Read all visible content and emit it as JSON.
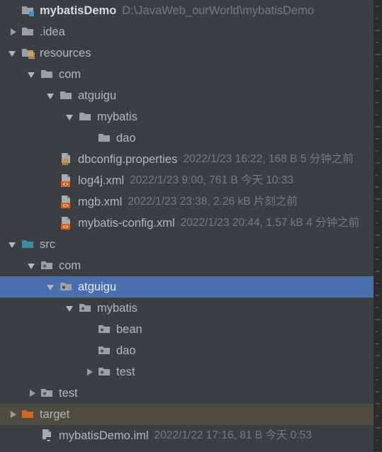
{
  "window": {
    "panel": "project-tree",
    "background_color": "#3c3f41",
    "selection_color": "#4b6eaf",
    "excluded_color": "#4e4b3f"
  },
  "tree": {
    "rows": [
      {
        "label": "mybatisDemo",
        "meta": "D:\\JavaWeb_ourWorld\\mybatisDemo",
        "meta_kind": "path",
        "icon": "project-folder-icon",
        "arrow": "none",
        "depth": 0,
        "bold": true,
        "state": "normal"
      },
      {
        "label": ".idea",
        "meta": "",
        "meta_kind": "none",
        "icon": "folder-icon",
        "arrow": "collapsed",
        "depth": 0,
        "bold": false,
        "state": "normal"
      },
      {
        "label": "resources",
        "meta": "",
        "meta_kind": "none",
        "icon": "resource-root-folder-icon",
        "arrow": "expanded",
        "depth": 0,
        "bold": false,
        "state": "normal"
      },
      {
        "label": "com",
        "meta": "",
        "meta_kind": "none",
        "icon": "folder-icon",
        "arrow": "expanded",
        "depth": 1,
        "bold": false,
        "state": "normal"
      },
      {
        "label": "atguigu",
        "meta": "",
        "meta_kind": "none",
        "icon": "folder-icon",
        "arrow": "expanded",
        "depth": 2,
        "bold": false,
        "state": "normal"
      },
      {
        "label": "mybatis",
        "meta": "",
        "meta_kind": "none",
        "icon": "folder-icon",
        "arrow": "expanded",
        "depth": 3,
        "bold": false,
        "state": "normal"
      },
      {
        "label": "dao",
        "meta": "",
        "meta_kind": "none",
        "icon": "folder-icon",
        "arrow": "none",
        "depth": 4,
        "bold": false,
        "state": "normal"
      },
      {
        "label": "dbconfig.properties",
        "meta": "2022/1/23 16:22, 168 B 5 分钟之前",
        "meta_kind": "file-info",
        "icon": "properties-file-icon",
        "arrow": "none",
        "depth": 2,
        "bold": false,
        "state": "normal"
      },
      {
        "label": "log4j.xml",
        "meta": "2022/1/23 9:00, 761 B 今天 10:33",
        "meta_kind": "file-info",
        "icon": "xml-file-icon",
        "arrow": "none",
        "depth": 2,
        "bold": false,
        "state": "normal"
      },
      {
        "label": "mgb.xml",
        "meta": "2022/1/23 23:38, 2.26 kB 片刻之前",
        "meta_kind": "file-info",
        "icon": "xml-file-icon",
        "arrow": "none",
        "depth": 2,
        "bold": false,
        "state": "normal"
      },
      {
        "label": "mybatis-config.xml",
        "meta": "2022/1/23 20:44, 1.57 kB 4 分钟之前",
        "meta_kind": "file-info",
        "icon": "xml-file-icon",
        "arrow": "none",
        "depth": 2,
        "bold": false,
        "state": "normal"
      },
      {
        "label": "src",
        "meta": "",
        "meta_kind": "none",
        "icon": "source-root-folder-icon",
        "arrow": "expanded",
        "depth": 0,
        "bold": false,
        "state": "normal"
      },
      {
        "label": "com",
        "meta": "",
        "meta_kind": "none",
        "icon": "package-icon",
        "arrow": "expanded",
        "depth": 1,
        "bold": false,
        "state": "normal"
      },
      {
        "label": "atguigu",
        "meta": "",
        "meta_kind": "none",
        "icon": "package-icon",
        "arrow": "expanded",
        "depth": 2,
        "bold": false,
        "state": "selected"
      },
      {
        "label": "mybatis",
        "meta": "",
        "meta_kind": "none",
        "icon": "package-icon",
        "arrow": "expanded",
        "depth": 3,
        "bold": false,
        "state": "normal"
      },
      {
        "label": "bean",
        "meta": "",
        "meta_kind": "none",
        "icon": "package-icon",
        "arrow": "none",
        "depth": 4,
        "bold": false,
        "state": "normal"
      },
      {
        "label": "dao",
        "meta": "",
        "meta_kind": "none",
        "icon": "package-icon",
        "arrow": "none",
        "depth": 4,
        "bold": false,
        "state": "normal"
      },
      {
        "label": "test",
        "meta": "",
        "meta_kind": "none",
        "icon": "package-icon",
        "arrow": "collapsed",
        "depth": 4,
        "bold": false,
        "state": "normal"
      },
      {
        "label": "test",
        "meta": "",
        "meta_kind": "none",
        "icon": "package-icon",
        "arrow": "collapsed",
        "depth": 1,
        "bold": false,
        "state": "normal"
      },
      {
        "label": "target",
        "meta": "",
        "meta_kind": "none",
        "icon": "excluded-folder-icon",
        "arrow": "collapsed",
        "depth": 0,
        "bold": false,
        "state": "excluded"
      },
      {
        "label": "mybatisDemo.iml",
        "meta": "2022/1/22 17:16, 81 B 今天 0:53",
        "meta_kind": "file-info",
        "icon": "iml-file-icon",
        "arrow": "none",
        "depth": 1,
        "bold": false,
        "state": "normal"
      }
    ]
  }
}
